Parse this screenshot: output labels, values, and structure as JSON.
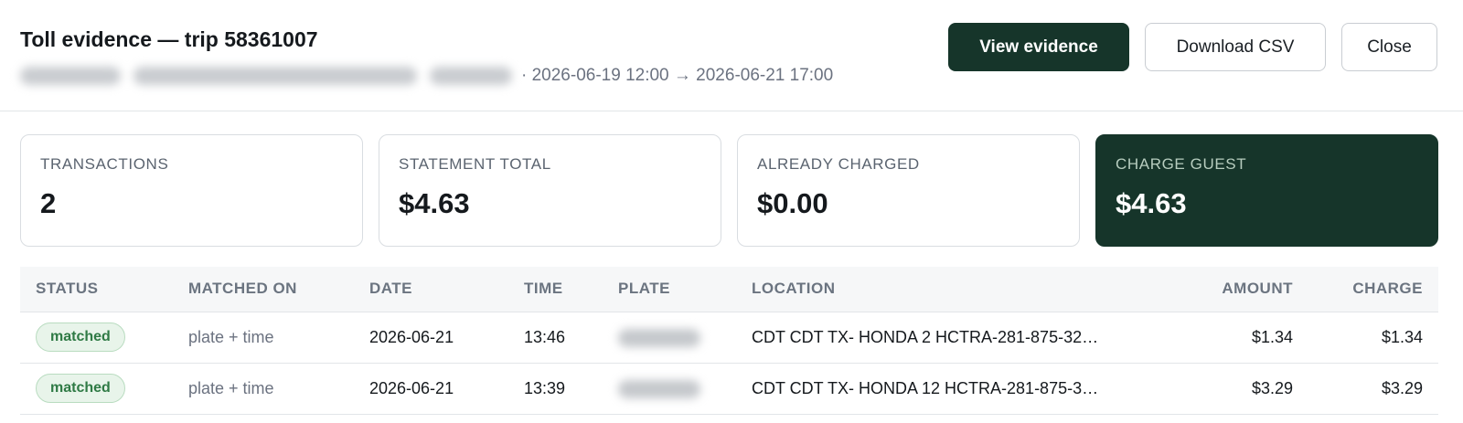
{
  "header": {
    "title": "Toll evidence — trip 58361007",
    "range": "· 2026-06-19 12:00 → 2026-06-21 17:00",
    "buttons": {
      "view": "View evidence",
      "download": "Download CSV",
      "close": "Close"
    }
  },
  "summary": [
    {
      "label": "TRANSACTIONS",
      "value": "2"
    },
    {
      "label": "STATEMENT TOTAL",
      "value": "$4.63"
    },
    {
      "label": "ALREADY CHARGED",
      "value": "$0.00"
    },
    {
      "label": "CHARGE GUEST",
      "value": "$4.63"
    }
  ],
  "table": {
    "columns": [
      "STATUS",
      "MATCHED ON",
      "DATE",
      "TIME",
      "PLATE",
      "LOCATION",
      "AMOUNT",
      "CHARGE"
    ],
    "rows": [
      {
        "status": "matched",
        "matched_on": "plate + time",
        "date": "2026-06-21",
        "time": "13:46",
        "location": "CDT CDT TX- HONDA 2 HCTRA-281-875-32…",
        "amount": "$1.34",
        "charge": "$1.34"
      },
      {
        "status": "matched",
        "matched_on": "plate + time",
        "date": "2026-06-21",
        "time": "13:39",
        "location": "CDT CDT TX- HONDA 12 HCTRA-281-875-3…",
        "amount": "$3.29",
        "charge": "$3.29"
      }
    ]
  },
  "colors": {
    "brand_dark": "#16352a",
    "badge_text": "#2f7a45",
    "badge_bg": "#e8f4ea"
  }
}
